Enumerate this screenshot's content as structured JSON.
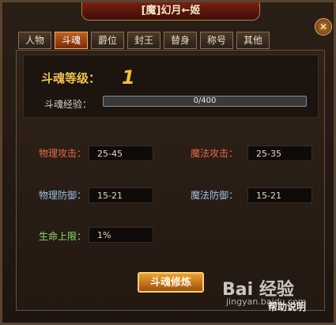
{
  "window": {
    "title": "[魔]幻月←姬"
  },
  "tabs": [
    {
      "label": "人物"
    },
    {
      "label": "斗魂",
      "active": true
    },
    {
      "label": "爵位"
    },
    {
      "label": "封王"
    },
    {
      "label": "替身"
    },
    {
      "label": "称号"
    },
    {
      "label": "其他"
    }
  ],
  "douhun": {
    "level_label": "斗魂等级：",
    "level_value": "1",
    "exp_label": "斗魂经验：",
    "exp_text": "0/400",
    "exp_fraction": 0
  },
  "stats": {
    "phys_atk": {
      "label": "物理攻击：",
      "value": "25-45"
    },
    "mag_atk": {
      "label": "魔法攻击：",
      "value": "25-35"
    },
    "phys_def": {
      "label": "物理防御：",
      "value": "15-21"
    },
    "mag_def": {
      "label": "魔法防御：",
      "value": "15-21"
    },
    "hp_limit": {
      "label": "生命上限：",
      "value": "1%"
    }
  },
  "buttons": {
    "train": "斗魂修炼",
    "help": "帮助说明"
  },
  "watermark": {
    "brand": "Bai 经验",
    "sub": "jingyan.baidu.com"
  }
}
